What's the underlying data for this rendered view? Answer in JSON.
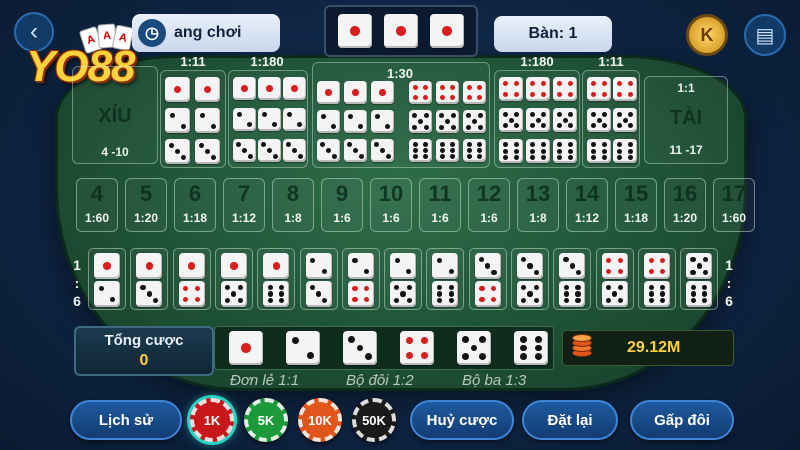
{
  "brand": {
    "logo_text": "YO88",
    "card_ranks": [
      "A",
      "A",
      "A"
    ]
  },
  "header": {
    "back_icon": "chevron-left-icon",
    "guide_label": "ang chơi",
    "guide_icon": "clock-icon",
    "result_dice": [
      1,
      1,
      1
    ],
    "table_label": "Bàn: 1",
    "coin_label": "K",
    "chat_icon": "chat-icon"
  },
  "top_zones": {
    "small": {
      "label": "XỈU",
      "range": "4 -10",
      "ratio": "1:1"
    },
    "big": {
      "label": "TÀI",
      "range": "11 -17",
      "ratio": "1:1"
    },
    "ratio_left_double": "1:11",
    "ratio_left_triple": "1:180",
    "ratio_any_triple": "1:30",
    "ratio_right_triple": "1:180",
    "ratio_right_double": "1:11"
  },
  "sums": [
    {
      "num": "4",
      "odds": "1:60"
    },
    {
      "num": "5",
      "odds": "1:20"
    },
    {
      "num": "6",
      "odds": "1:18"
    },
    {
      "num": "7",
      "odds": "1:12"
    },
    {
      "num": "8",
      "odds": "1:8"
    },
    {
      "num": "9",
      "odds": "1:6"
    },
    {
      "num": "10",
      "odds": "1:6"
    },
    {
      "num": "11",
      "odds": "1:6"
    },
    {
      "num": "12",
      "odds": "1:6"
    },
    {
      "num": "13",
      "odds": "1:8"
    },
    {
      "num": "14",
      "odds": "1:12"
    },
    {
      "num": "15",
      "odds": "1:18"
    },
    {
      "num": "16",
      "odds": "1:20"
    },
    {
      "num": "17",
      "odds": "1:60"
    }
  ],
  "pair_ratio": {
    "top": "1",
    "mid": ":",
    "bottom": "6"
  },
  "bottom_info": {
    "total_label": "Tổng cược",
    "total_value": "0",
    "balance": "29.12M"
  },
  "legend": {
    "single": "Đơn lẻ 1:1",
    "double": "Bộ đôi 1:2",
    "triple": "Bộ ba 1:3"
  },
  "buttons": {
    "history": "Lịch sử",
    "cancel": "Huỷ cược",
    "reset": "Đặt lại",
    "double": "Gấp đôi"
  },
  "chips": [
    {
      "label": "1K",
      "color": "#c8171b",
      "selected": true
    },
    {
      "label": "5K",
      "color": "#1c9a3a",
      "selected": false
    },
    {
      "label": "10K",
      "color": "#e0561a",
      "selected": false
    },
    {
      "label": "50K",
      "color": "#1a1a1a",
      "selected": false
    }
  ],
  "colors": {
    "felt": "#1f5236",
    "accent_gold": "#ffd23a",
    "button_blue": "#1e5aa0"
  }
}
